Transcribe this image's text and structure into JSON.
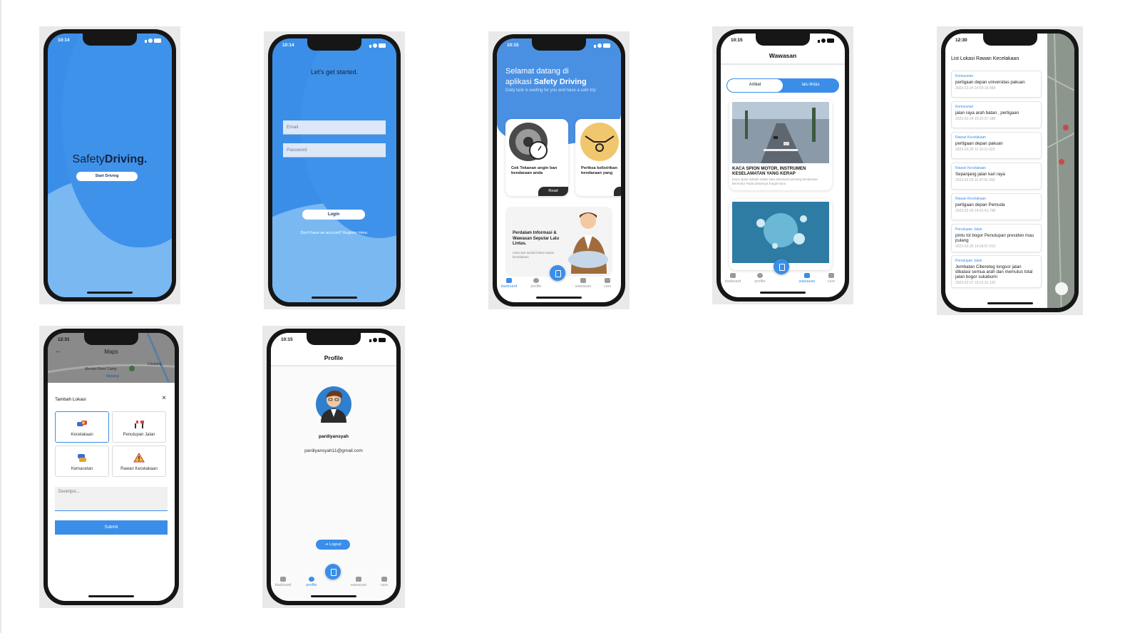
{
  "screens": {
    "splash": {
      "time": "10:14",
      "brand_light": "Safety",
      "brand_bold": "Driving.",
      "start_button": "Start Driving"
    },
    "login": {
      "time": "10:14",
      "heading": "Let's get started.",
      "email_placeholder": "Email",
      "password_placeholder": "Password",
      "login_button": "Login",
      "register_text": "Don't have an account? Register Here."
    },
    "dashboard": {
      "time": "10:15",
      "welcome_line1": "Selamat datang di",
      "welcome_line2_prefix": "aplikasi ",
      "welcome_line2_bold": "Safety Driving",
      "tagline": "Daily task is waiting for you and have a safe trip",
      "card1_text": "Cek Tekanan angin ban kendaraan anda",
      "card1_button": "Read",
      "card2_text": "Periksa kelistrikan kendaraan yang",
      "info_title": "Perdalam Informasi & Wawasan Seputar Lalu Lintas.",
      "info_sub": "Lihat dan tandai lokasi rawan kecelakaan",
      "nav": [
        "dasboard",
        "profile",
        "wawasan",
        "care"
      ]
    },
    "wawasan": {
      "time": "10:15",
      "title": "Wawasan",
      "tab_artikel": "Artikel",
      "tab_lalu_lintas": "lalu lintas",
      "article1_title": "KACA SPION MOTOR, INSTRUMEN KESELAMATAN YANG KERAP",
      "article1_excerpt": "Kaca spion adalah salah satu aksesoris penting kendaraan bermotor Pada dasarnya fungsi kaca",
      "nav": [
        "dasboard",
        "profile",
        "wawasan",
        "care"
      ]
    },
    "list": {
      "time": "12:30",
      "title": "List Lokasi Rawan Kecelakaan",
      "items": [
        {
          "category": "Kemacetan",
          "name": "perligaan depan universitas pakuan",
          "date": "2023-02-24 14:50:19.958"
        },
        {
          "category": "Kemacetan",
          "name": "jalan raya arah batan , pertigaan",
          "date": "2023-02-24 15:22:27.188"
        },
        {
          "category": "Rawan Kecelakaan",
          "name": "pertigaan depan pakuan",
          "date": "2023-02-25 11:10:11.023"
        },
        {
          "category": "Rawan Kecelakaan",
          "name": "Sepanjang jalan kari raya",
          "date": "2023-02-25 11:47:51.565"
        },
        {
          "category": "Rawan Kecelakaan",
          "name": "pertigaan depan Pemuda",
          "date": "2023-02-26 14:41:41.798"
        },
        {
          "category": "Penutupan Jalan",
          "name": "pintu tol bogor Penutupan presiden mau pulang",
          "date": "2023-02-26 14:18:57.013"
        },
        {
          "category": "Penutupan Jalan",
          "name": "Jembatan Cibereteg longsor jalan dibatasi semua arah dan memutus total jalan bogor sukabumi",
          "date": "2023-02-27 16:31:31.126"
        }
      ]
    },
    "maps": {
      "time": "12:31",
      "title": "Maps",
      "map_label1": "Mentari River Camp",
      "map_label2": "Mayang",
      "map_label3": "Cisalang",
      "sheet_title": "Tambah Lokasi",
      "options": [
        "Kecelakaan",
        "Penutupan Jalan",
        "Kemacetan",
        "Rawan Kecelakaan"
      ],
      "description_placeholder": "Deskripsi...",
      "submit_button": "Submit"
    },
    "profile": {
      "time": "10:15",
      "title": "Profile",
      "username": "pardiyansyah",
      "email": "pardiyansyah11@gmail.com",
      "logout_button": "Logout",
      "nav": [
        "dasboard",
        "profile",
        "wawasan",
        "care"
      ]
    }
  },
  "colors": {
    "primary_blue": "#3a8ee8",
    "light_blue": "#6fb0ee",
    "dark_frame": "#161616"
  }
}
